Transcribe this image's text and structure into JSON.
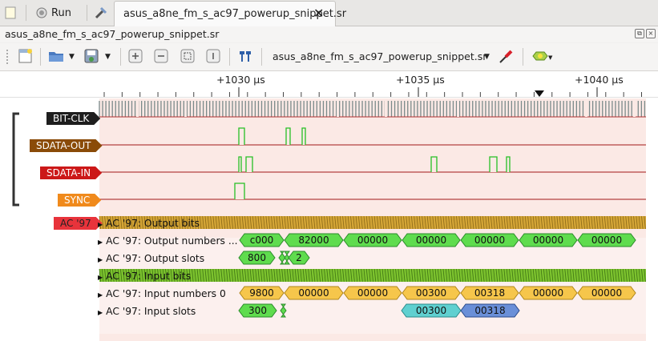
{
  "tabbar": {
    "run_label": "Run",
    "document_tab": "asus_a8ne_fm_s_ac97_powerup_snippet.sr"
  },
  "session": {
    "title": "asus_a8ne_fm_s_ac97_powerup_snippet.sr"
  },
  "toolbar": {
    "device_selector": "asus_a8ne_fm_s_ac97_powerup_snippet.sr"
  },
  "ruler": {
    "ticks": [
      "+1030 µs",
      "+1035 µs",
      "+1040 µs"
    ]
  },
  "channels": [
    {
      "name": "BIT-CLK",
      "color": "#1e1e1e"
    },
    {
      "name": "SDATA-OUT",
      "color": "#8a4b08"
    },
    {
      "name": "SDATA-IN",
      "color": "#cc1818"
    },
    {
      "name": "SYNC",
      "color": "#f08a1c"
    }
  ],
  "decoder": {
    "name": "AC '97",
    "color": "#e8333b",
    "rows": {
      "output_bits": "AC '97: Output bits",
      "output_numbers": "AC '97: Output numbers ...",
      "output_slots": "AC '97: Output slots",
      "input_bits": "AC '97: Input bits",
      "input_numbers": "AC '97: Input numbers 0",
      "input_slots": "AC '97: Input slots"
    },
    "output_number_values": [
      "c000",
      "82000",
      "00000",
      "00000",
      "00000",
      "00000",
      "00000"
    ],
    "output_slot_values": [
      "800",
      "2"
    ],
    "input_number_values": [
      "9800",
      "00000",
      "00000",
      "00300",
      "00318",
      "00000",
      "00000"
    ],
    "input_slot_values": [
      "300",
      "00300",
      "00318"
    ]
  },
  "colors": {
    "annotation_green": "#5fdc4e",
    "annotation_yellow": "#f6c64b",
    "slot_cyan": "#5fd0d0",
    "slot_blue": "#6a8fd8",
    "trace_bg": "#fbe9e5"
  }
}
